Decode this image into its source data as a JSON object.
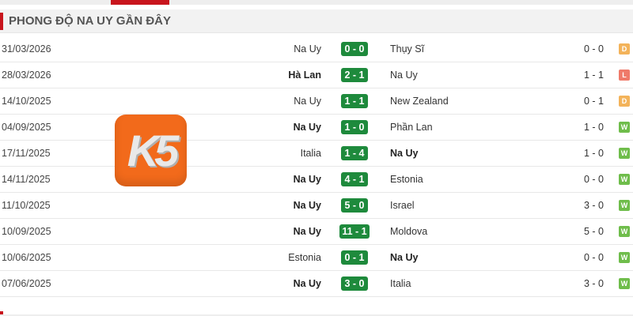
{
  "section": {
    "title": "PHONG ĐỘ NA UY GẦN ĐÂY"
  },
  "logo": {
    "text": "K5"
  },
  "colors": {
    "accent": "#c8151d",
    "score_bg": "#1e8a3c",
    "win": "#6fbd4b",
    "draw": "#f3b35a",
    "loss": "#ef7a6a",
    "logo_bg": "#f26a1b"
  },
  "matches": [
    {
      "date": "31/03/2026",
      "home": "Na Uy",
      "score": "0 - 0",
      "away": "Thụy Sĩ",
      "ht": "0 - 0",
      "result": "D",
      "strong": "none"
    },
    {
      "date": "28/03/2026",
      "home": "Hà Lan",
      "score": "2 - 1",
      "away": "Na Uy",
      "ht": "1 - 1",
      "result": "L",
      "strong": "home"
    },
    {
      "date": "14/10/2025",
      "home": "Na Uy",
      "score": "1 - 1",
      "away": "New Zealand",
      "ht": "0 - 1",
      "result": "D",
      "strong": "none"
    },
    {
      "date": "04/09/2025",
      "home": "Na Uy",
      "score": "1 - 0",
      "away": "Phần Lan",
      "ht": "1 - 0",
      "result": "W",
      "strong": "home"
    },
    {
      "date": "17/11/2025",
      "home": "Italia",
      "score": "1 - 4",
      "away": "Na Uy",
      "ht": "1 - 0",
      "result": "W",
      "strong": "away"
    },
    {
      "date": "14/11/2025",
      "home": "Na Uy",
      "score": "4 - 1",
      "away": "Estonia",
      "ht": "0 - 0",
      "result": "W",
      "strong": "home"
    },
    {
      "date": "11/10/2025",
      "home": "Na Uy",
      "score": "5 - 0",
      "away": "Israel",
      "ht": "3 - 0",
      "result": "W",
      "strong": "home"
    },
    {
      "date": "10/09/2025",
      "home": "Na Uy",
      "score": "11 - 1",
      "away": "Moldova",
      "ht": "5 - 0",
      "result": "W",
      "strong": "home"
    },
    {
      "date": "10/06/2025",
      "home": "Estonia",
      "score": "0 - 1",
      "away": "Na Uy",
      "ht": "0 - 0",
      "result": "W",
      "strong": "away"
    },
    {
      "date": "07/06/2025",
      "home": "Na Uy",
      "score": "3 - 0",
      "away": "Italia",
      "ht": "3 - 0",
      "result": "W",
      "strong": "home"
    }
  ]
}
